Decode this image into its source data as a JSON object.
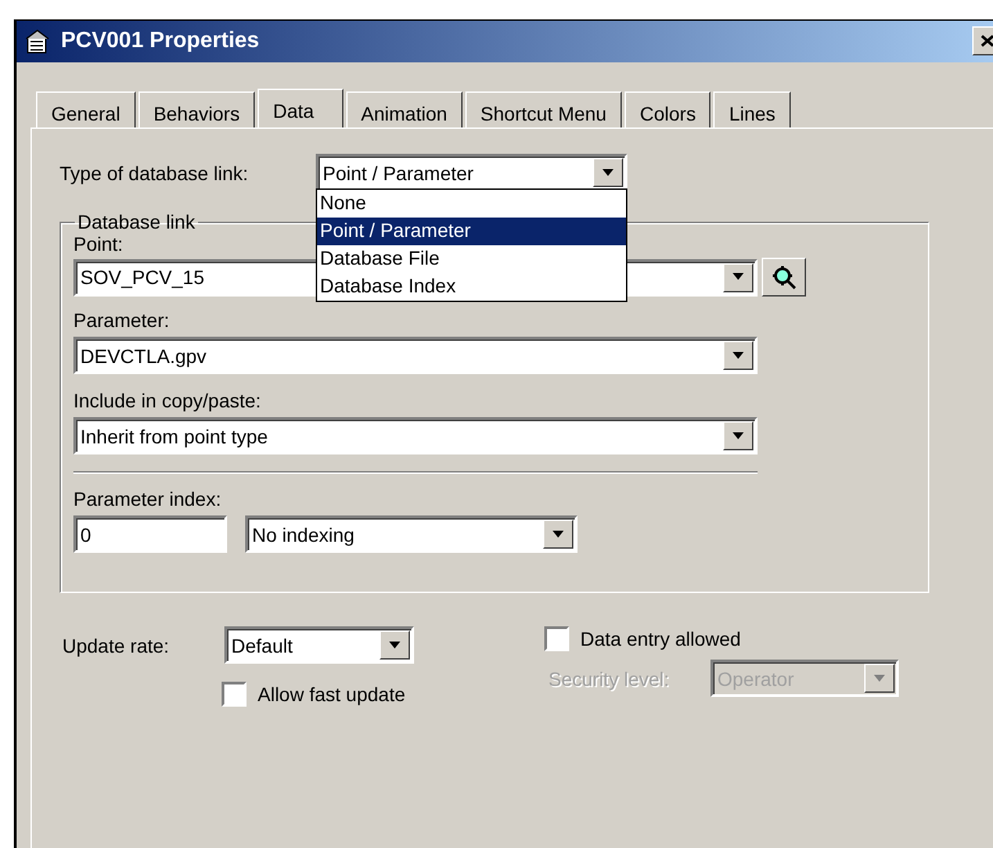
{
  "window": {
    "title": "PCV001 Properties"
  },
  "tabs": [
    {
      "label": "General",
      "selected": false
    },
    {
      "label": "Behaviors",
      "selected": false
    },
    {
      "label": "Data",
      "selected": true
    },
    {
      "label": "Animation",
      "selected": false
    },
    {
      "label": "Shortcut Menu",
      "selected": false
    },
    {
      "label": "Colors",
      "selected": false
    },
    {
      "label": "Lines",
      "selected": false
    }
  ],
  "database_link_type": {
    "label": "Type of database link:",
    "value": "Point / Parameter",
    "expanded": true,
    "options": [
      {
        "label": "None",
        "selected": false
      },
      {
        "label": "Point / Parameter",
        "selected": true
      },
      {
        "label": "Database File",
        "selected": false
      },
      {
        "label": "Database Index",
        "selected": false
      }
    ]
  },
  "database_link": {
    "title": "Database link",
    "point": {
      "label": "Point:",
      "value": "SOV_PCV_15"
    },
    "parameter": {
      "label": "Parameter:",
      "value": "DEVCTLA.gpv"
    },
    "copy_paste": {
      "label": "Include in copy/paste:",
      "value": "Inherit from point type"
    },
    "parameter_index": {
      "label": "Parameter index:",
      "value": "0",
      "mode": "No indexing"
    }
  },
  "update_rate": {
    "label": "Update rate:",
    "value": "Default"
  },
  "allow_fast_update": {
    "label": "Allow fast update",
    "checked": false
  },
  "data_entry_allowed": {
    "label": "Data entry allowed",
    "checked": false
  },
  "security_level": {
    "label": "Security level:",
    "value": "Operator",
    "disabled": true
  }
}
